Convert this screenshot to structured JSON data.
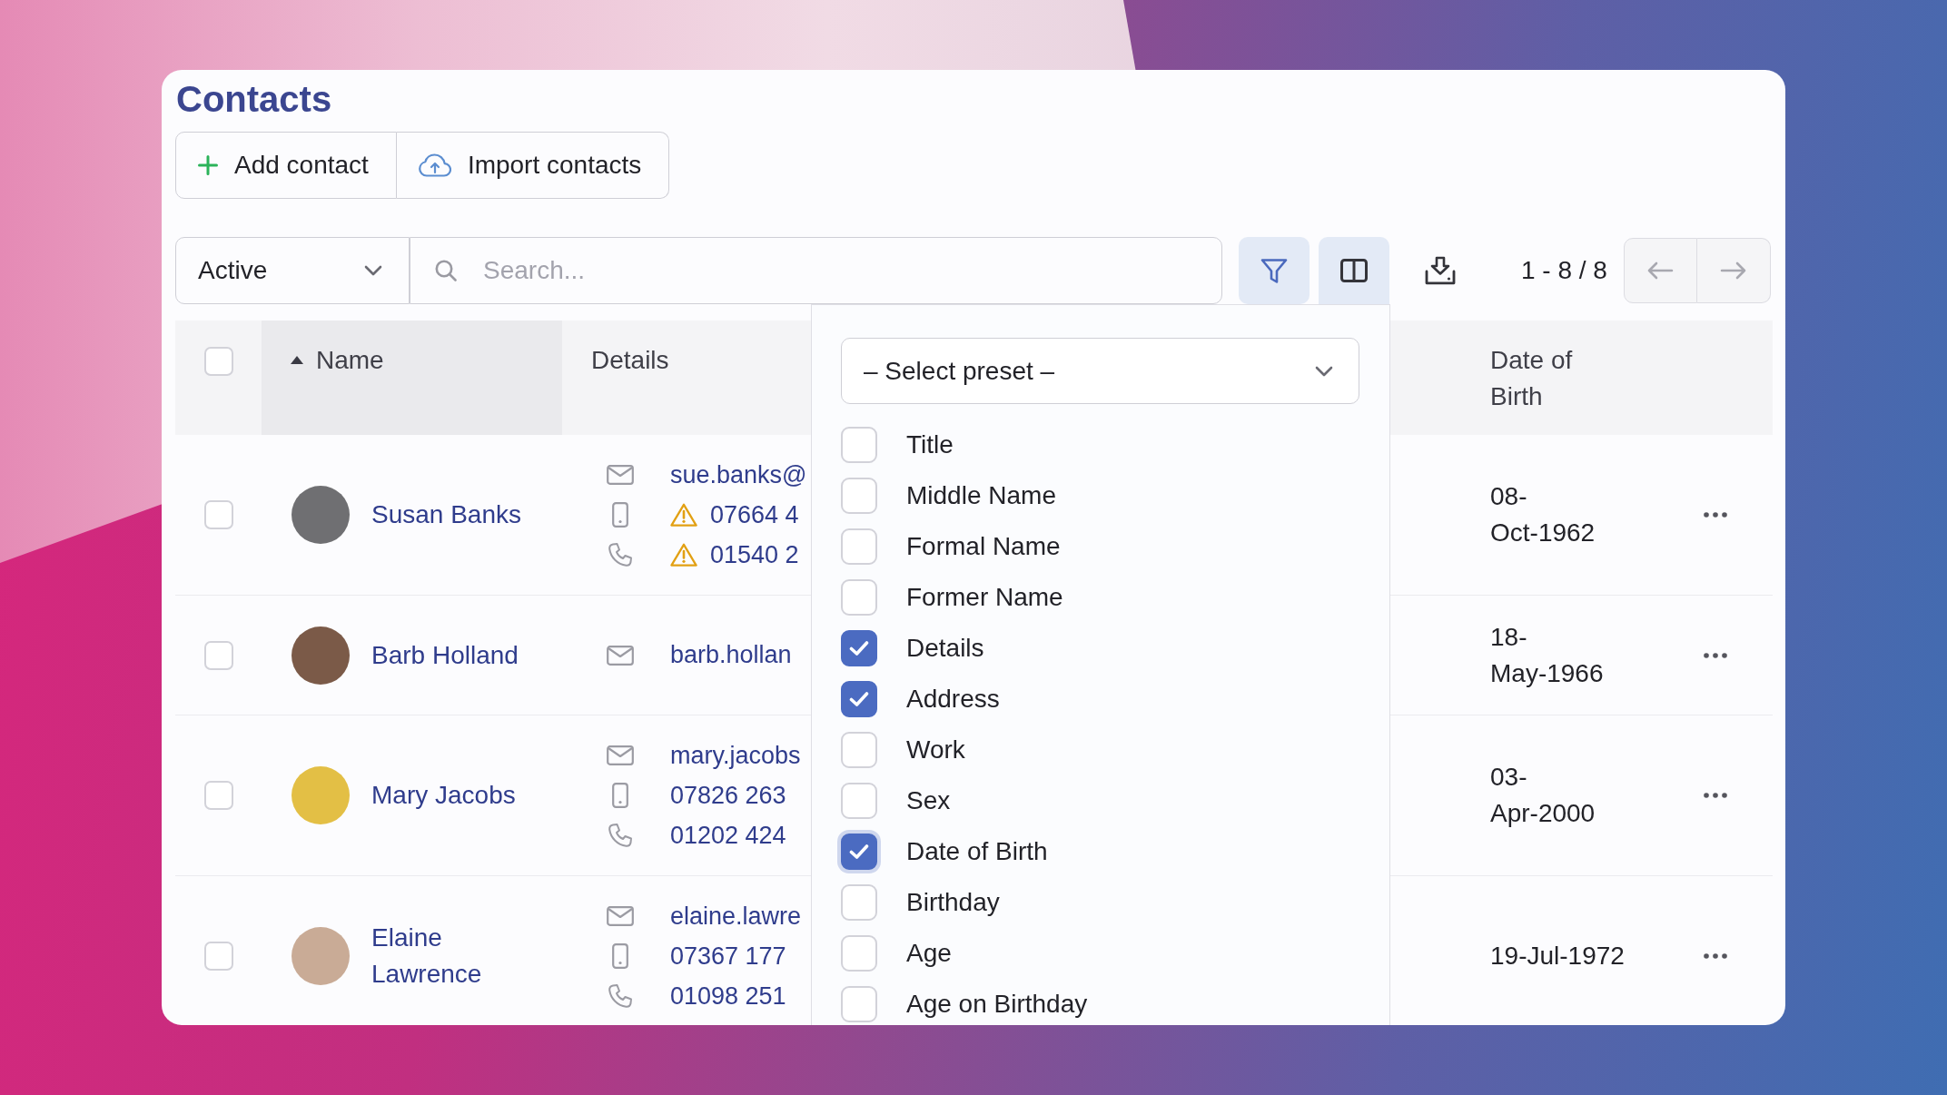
{
  "window": {
    "title": "Contacts"
  },
  "actions": [
    {
      "kind": "add",
      "label": "Add contact"
    },
    {
      "kind": "import",
      "label": "Import contacts"
    }
  ],
  "toolbar": {
    "status_select": {
      "value": "Active"
    },
    "search": {
      "placeholder": "Search..."
    },
    "tools": [
      {
        "kind": "filter",
        "active": true
      },
      {
        "kind": "columns",
        "active": true
      },
      {
        "kind": "download",
        "active": false
      }
    ],
    "page_range": "1 - 8 / 8",
    "pager": [
      {
        "kind": "previous",
        "disabled": true
      },
      {
        "kind": "next",
        "disabled": true
      }
    ]
  },
  "table": {
    "select_all": {
      "checked": false
    },
    "columns": [
      {
        "label": "Name",
        "sorted": true
      },
      {
        "label": "Details",
        "sorted": false
      },
      {
        "label": "Date of Birth",
        "sorted": false
      }
    ],
    "rows": [
      {
        "checked": false,
        "avatar": {
          "color": "#6f6f72"
        },
        "name": "Susan Banks",
        "details": [
          {
            "kind": "email",
            "text": "sue.banks@",
            "warning": false
          },
          {
            "kind": "mobile",
            "text": "07664 4",
            "warning": true
          },
          {
            "kind": "phone",
            "text": "01540 2",
            "warning": true
          }
        ],
        "date_of_birth": "08-Oct-1962"
      },
      {
        "checked": false,
        "avatar": {
          "color": "#7b5a48"
        },
        "name": "Barb Holland",
        "details": [
          {
            "kind": "email",
            "text": "barb.hollan",
            "warning": false
          }
        ],
        "date_of_birth": "18-May-1966"
      },
      {
        "checked": false,
        "avatar": {
          "color": "#e3bf45"
        },
        "name": "Mary Jacobs",
        "details": [
          {
            "kind": "email",
            "text": "mary.jacobs",
            "warning": false
          },
          {
            "kind": "mobile",
            "text": "07826 263",
            "warning": false
          },
          {
            "kind": "phone",
            "text": "01202 424",
            "warning": false
          }
        ],
        "date_of_birth": "03-Apr-2000"
      },
      {
        "checked": false,
        "avatar": {
          "color": "#c9ab96"
        },
        "name": "Elaine Lawrence",
        "details": [
          {
            "kind": "email",
            "text": "elaine.lawre",
            "warning": false
          },
          {
            "kind": "mobile",
            "text": "07367 177",
            "warning": false
          },
          {
            "kind": "phone",
            "text": "01098 251",
            "warning": false
          }
        ],
        "date_of_birth": "19-Jul-1972"
      }
    ]
  },
  "column_picker": {
    "preset": {
      "value": "– Select preset –"
    },
    "options": [
      {
        "label": "Title",
        "checked": false,
        "focused": false
      },
      {
        "label": "Middle Name",
        "checked": false,
        "focused": false
      },
      {
        "label": "Formal Name",
        "checked": false,
        "focused": false
      },
      {
        "label": "Former Name",
        "checked": false,
        "focused": false
      },
      {
        "label": "Details",
        "checked": true,
        "focused": false
      },
      {
        "label": "Address",
        "checked": true,
        "focused": false
      },
      {
        "label": "Work",
        "checked": false,
        "focused": false
      },
      {
        "label": "Sex",
        "checked": false,
        "focused": false
      },
      {
        "label": "Date of Birth",
        "checked": true,
        "focused": true
      },
      {
        "label": "Birthday",
        "checked": false,
        "focused": false
      },
      {
        "label": "Age",
        "checked": false,
        "focused": false
      },
      {
        "label": "Age on Birthday",
        "checked": false,
        "focused": false
      }
    ]
  }
}
